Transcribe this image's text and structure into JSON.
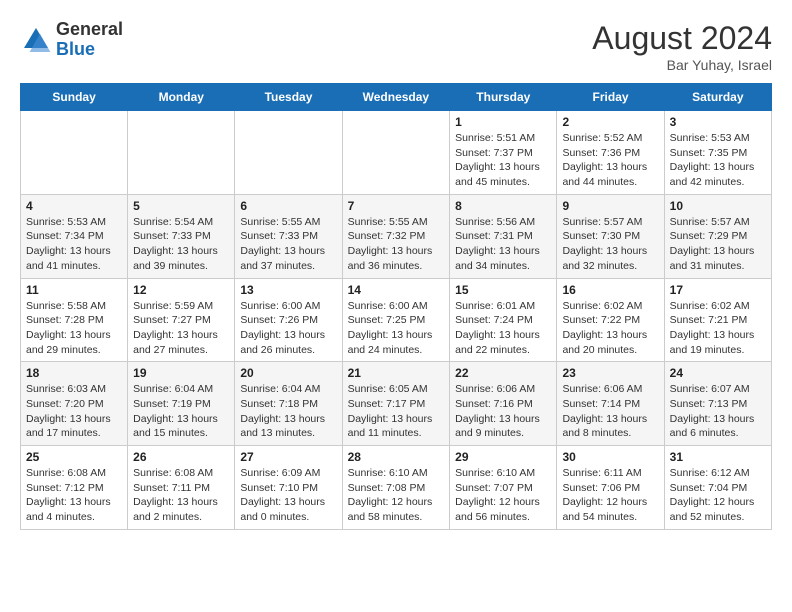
{
  "logo": {
    "general": "General",
    "blue": "Blue"
  },
  "title": {
    "month_year": "August 2024",
    "location": "Bar Yuhay, Israel"
  },
  "days_of_week": [
    "Sunday",
    "Monday",
    "Tuesday",
    "Wednesday",
    "Thursday",
    "Friday",
    "Saturday"
  ],
  "weeks": [
    [
      {
        "day": "",
        "sunrise": "",
        "sunset": "",
        "daylight": ""
      },
      {
        "day": "",
        "sunrise": "",
        "sunset": "",
        "daylight": ""
      },
      {
        "day": "",
        "sunrise": "",
        "sunset": "",
        "daylight": ""
      },
      {
        "day": "",
        "sunrise": "",
        "sunset": "",
        "daylight": ""
      },
      {
        "day": "1",
        "sunrise": "Sunrise: 5:51 AM",
        "sunset": "Sunset: 7:37 PM",
        "daylight": "Daylight: 13 hours and 45 minutes."
      },
      {
        "day": "2",
        "sunrise": "Sunrise: 5:52 AM",
        "sunset": "Sunset: 7:36 PM",
        "daylight": "Daylight: 13 hours and 44 minutes."
      },
      {
        "day": "3",
        "sunrise": "Sunrise: 5:53 AM",
        "sunset": "Sunset: 7:35 PM",
        "daylight": "Daylight: 13 hours and 42 minutes."
      }
    ],
    [
      {
        "day": "4",
        "sunrise": "Sunrise: 5:53 AM",
        "sunset": "Sunset: 7:34 PM",
        "daylight": "Daylight: 13 hours and 41 minutes."
      },
      {
        "day": "5",
        "sunrise": "Sunrise: 5:54 AM",
        "sunset": "Sunset: 7:33 PM",
        "daylight": "Daylight: 13 hours and 39 minutes."
      },
      {
        "day": "6",
        "sunrise": "Sunrise: 5:55 AM",
        "sunset": "Sunset: 7:33 PM",
        "daylight": "Daylight: 13 hours and 37 minutes."
      },
      {
        "day": "7",
        "sunrise": "Sunrise: 5:55 AM",
        "sunset": "Sunset: 7:32 PM",
        "daylight": "Daylight: 13 hours and 36 minutes."
      },
      {
        "day": "8",
        "sunrise": "Sunrise: 5:56 AM",
        "sunset": "Sunset: 7:31 PM",
        "daylight": "Daylight: 13 hours and 34 minutes."
      },
      {
        "day": "9",
        "sunrise": "Sunrise: 5:57 AM",
        "sunset": "Sunset: 7:30 PM",
        "daylight": "Daylight: 13 hours and 32 minutes."
      },
      {
        "day": "10",
        "sunrise": "Sunrise: 5:57 AM",
        "sunset": "Sunset: 7:29 PM",
        "daylight": "Daylight: 13 hours and 31 minutes."
      }
    ],
    [
      {
        "day": "11",
        "sunrise": "Sunrise: 5:58 AM",
        "sunset": "Sunset: 7:28 PM",
        "daylight": "Daylight: 13 hours and 29 minutes."
      },
      {
        "day": "12",
        "sunrise": "Sunrise: 5:59 AM",
        "sunset": "Sunset: 7:27 PM",
        "daylight": "Daylight: 13 hours and 27 minutes."
      },
      {
        "day": "13",
        "sunrise": "Sunrise: 6:00 AM",
        "sunset": "Sunset: 7:26 PM",
        "daylight": "Daylight: 13 hours and 26 minutes."
      },
      {
        "day": "14",
        "sunrise": "Sunrise: 6:00 AM",
        "sunset": "Sunset: 7:25 PM",
        "daylight": "Daylight: 13 hours and 24 minutes."
      },
      {
        "day": "15",
        "sunrise": "Sunrise: 6:01 AM",
        "sunset": "Sunset: 7:24 PM",
        "daylight": "Daylight: 13 hours and 22 minutes."
      },
      {
        "day": "16",
        "sunrise": "Sunrise: 6:02 AM",
        "sunset": "Sunset: 7:22 PM",
        "daylight": "Daylight: 13 hours and 20 minutes."
      },
      {
        "day": "17",
        "sunrise": "Sunrise: 6:02 AM",
        "sunset": "Sunset: 7:21 PM",
        "daylight": "Daylight: 13 hours and 19 minutes."
      }
    ],
    [
      {
        "day": "18",
        "sunrise": "Sunrise: 6:03 AM",
        "sunset": "Sunset: 7:20 PM",
        "daylight": "Daylight: 13 hours and 17 minutes."
      },
      {
        "day": "19",
        "sunrise": "Sunrise: 6:04 AM",
        "sunset": "Sunset: 7:19 PM",
        "daylight": "Daylight: 13 hours and 15 minutes."
      },
      {
        "day": "20",
        "sunrise": "Sunrise: 6:04 AM",
        "sunset": "Sunset: 7:18 PM",
        "daylight": "Daylight: 13 hours and 13 minutes."
      },
      {
        "day": "21",
        "sunrise": "Sunrise: 6:05 AM",
        "sunset": "Sunset: 7:17 PM",
        "daylight": "Daylight: 13 hours and 11 minutes."
      },
      {
        "day": "22",
        "sunrise": "Sunrise: 6:06 AM",
        "sunset": "Sunset: 7:16 PM",
        "daylight": "Daylight: 13 hours and 9 minutes."
      },
      {
        "day": "23",
        "sunrise": "Sunrise: 6:06 AM",
        "sunset": "Sunset: 7:14 PM",
        "daylight": "Daylight: 13 hours and 8 minutes."
      },
      {
        "day": "24",
        "sunrise": "Sunrise: 6:07 AM",
        "sunset": "Sunset: 7:13 PM",
        "daylight": "Daylight: 13 hours and 6 minutes."
      }
    ],
    [
      {
        "day": "25",
        "sunrise": "Sunrise: 6:08 AM",
        "sunset": "Sunset: 7:12 PM",
        "daylight": "Daylight: 13 hours and 4 minutes."
      },
      {
        "day": "26",
        "sunrise": "Sunrise: 6:08 AM",
        "sunset": "Sunset: 7:11 PM",
        "daylight": "Daylight: 13 hours and 2 minutes."
      },
      {
        "day": "27",
        "sunrise": "Sunrise: 6:09 AM",
        "sunset": "Sunset: 7:10 PM",
        "daylight": "Daylight: 13 hours and 0 minutes."
      },
      {
        "day": "28",
        "sunrise": "Sunrise: 6:10 AM",
        "sunset": "Sunset: 7:08 PM",
        "daylight": "Daylight: 12 hours and 58 minutes."
      },
      {
        "day": "29",
        "sunrise": "Sunrise: 6:10 AM",
        "sunset": "Sunset: 7:07 PM",
        "daylight": "Daylight: 12 hours and 56 minutes."
      },
      {
        "day": "30",
        "sunrise": "Sunrise: 6:11 AM",
        "sunset": "Sunset: 7:06 PM",
        "daylight": "Daylight: 12 hours and 54 minutes."
      },
      {
        "day": "31",
        "sunrise": "Sunrise: 6:12 AM",
        "sunset": "Sunset: 7:04 PM",
        "daylight": "Daylight: 12 hours and 52 minutes."
      }
    ]
  ]
}
